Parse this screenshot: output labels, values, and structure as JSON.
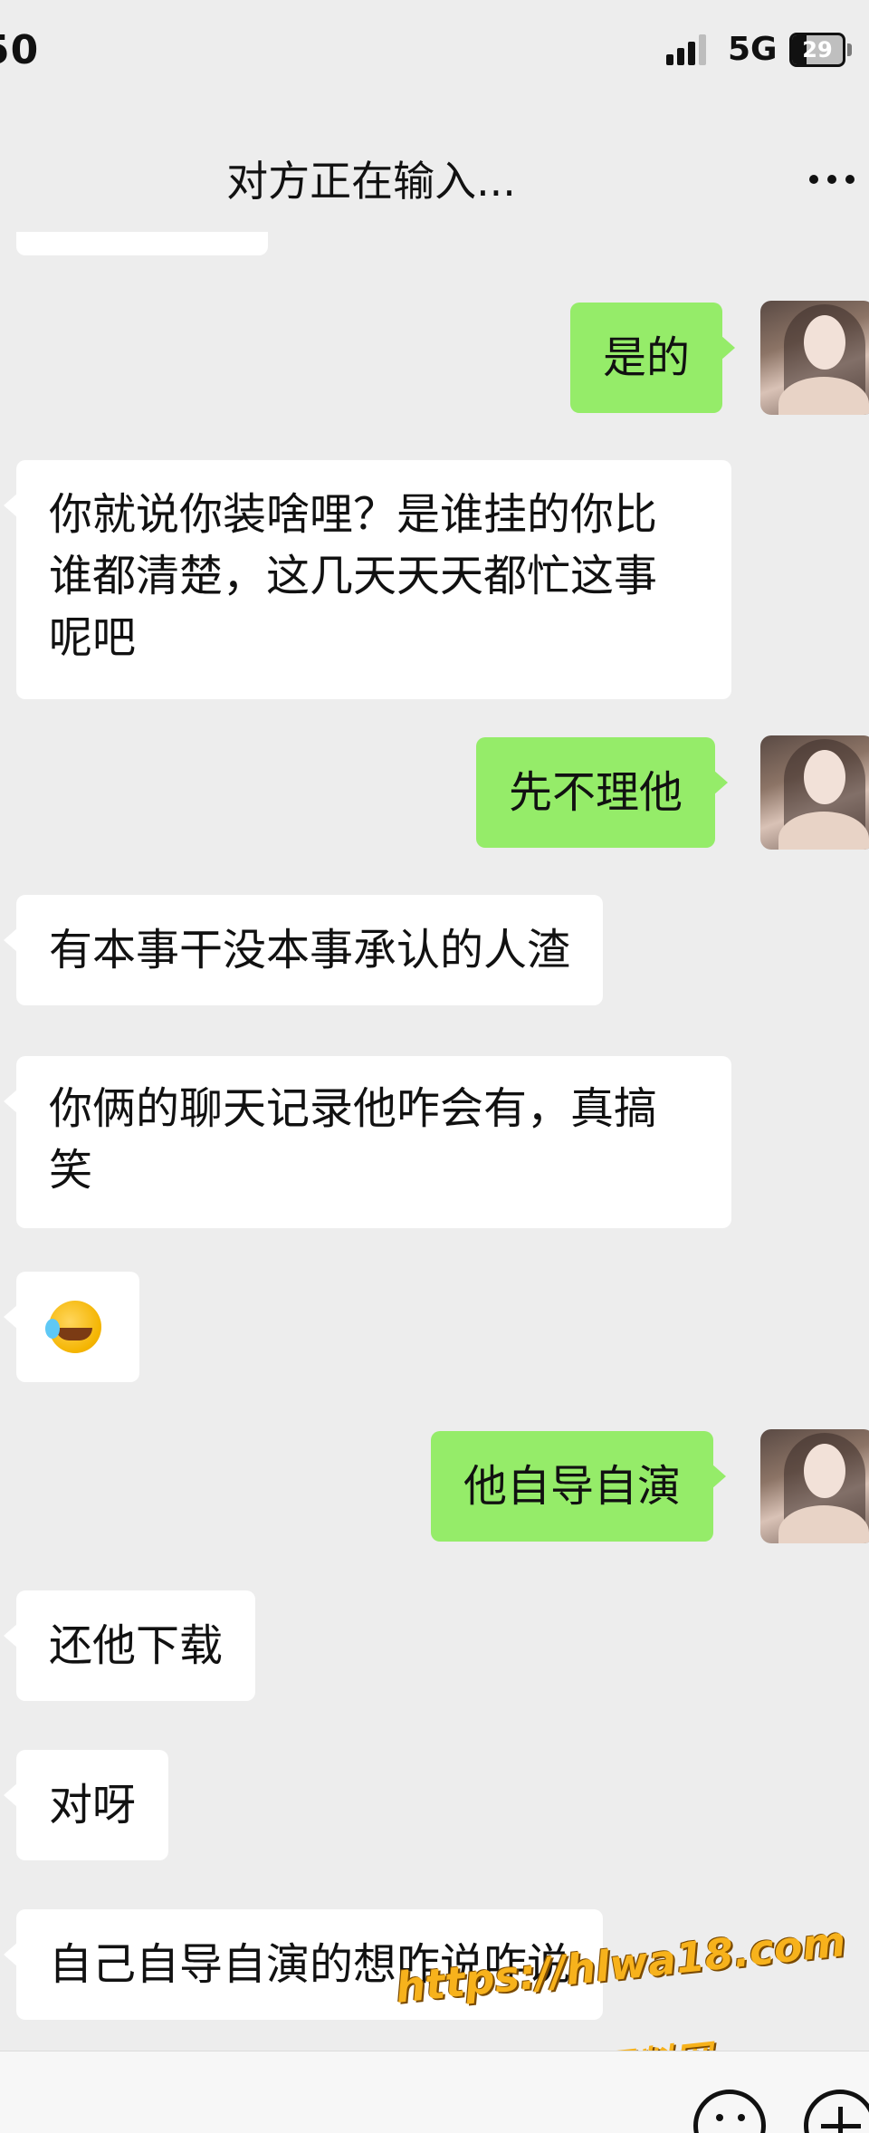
{
  "status_bar": {
    "time": "50",
    "network": "5G",
    "battery": "29",
    "battery_level_percent": 29
  },
  "nav": {
    "title": "对方正在输入...",
    "more_icon": "more-dots-icon"
  },
  "messages": [
    {
      "side": "in",
      "text": ""
    },
    {
      "side": "out",
      "text": "是的"
    },
    {
      "side": "in",
      "text": "你就说你装啥哩？是谁挂的你比谁都清楚，这几天天天都忙这事呢吧"
    },
    {
      "side": "out",
      "text": "先不理他"
    },
    {
      "side": "in",
      "text": "有本事干没本事承认的人渣"
    },
    {
      "side": "in",
      "text": "你俩的聊天记录他咋会有，真搞笑"
    },
    {
      "side": "in",
      "emoji": "laughing-crying-emoji"
    },
    {
      "side": "out",
      "text": "他自导自演"
    },
    {
      "side": "in",
      "text": "还他下载"
    },
    {
      "side": "in",
      "text": "对呀"
    },
    {
      "side": "in",
      "text": "自己自导自演的想咋说咋说"
    }
  ],
  "watermark": {
    "url": "https://hlwa18.com",
    "label": "黑料网"
  },
  "colors": {
    "background": "#ededed",
    "incoming_bubble": "#ffffff",
    "outgoing_bubble": "#95ec69",
    "watermark": "#f7b21c"
  }
}
